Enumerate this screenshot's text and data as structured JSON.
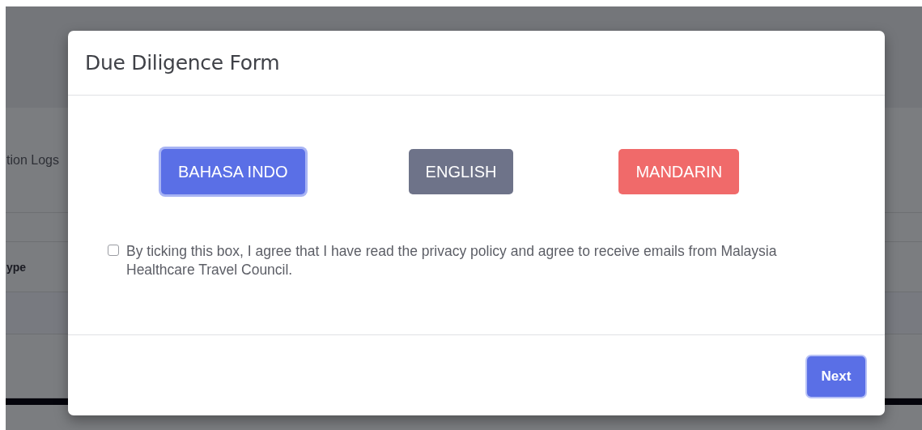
{
  "background_page": {
    "section_label": "tion Logs",
    "column_header": "ype"
  },
  "modal": {
    "title": "Due Diligence Form",
    "languages": [
      {
        "label": "BAHASA INDO",
        "color": "#5a6fe6",
        "selected": true
      },
      {
        "label": "ENGLISH",
        "color": "#6e7389",
        "selected": false
      },
      {
        "label": "MANDARIN",
        "color": "#f06a6a",
        "selected": false
      }
    ],
    "consent": {
      "checked": false,
      "text": "By ticking this box, I agree that I have read the privacy policy and agree to receive emails from Malaysia Healthcare Travel Council."
    },
    "next_button": "Next"
  }
}
